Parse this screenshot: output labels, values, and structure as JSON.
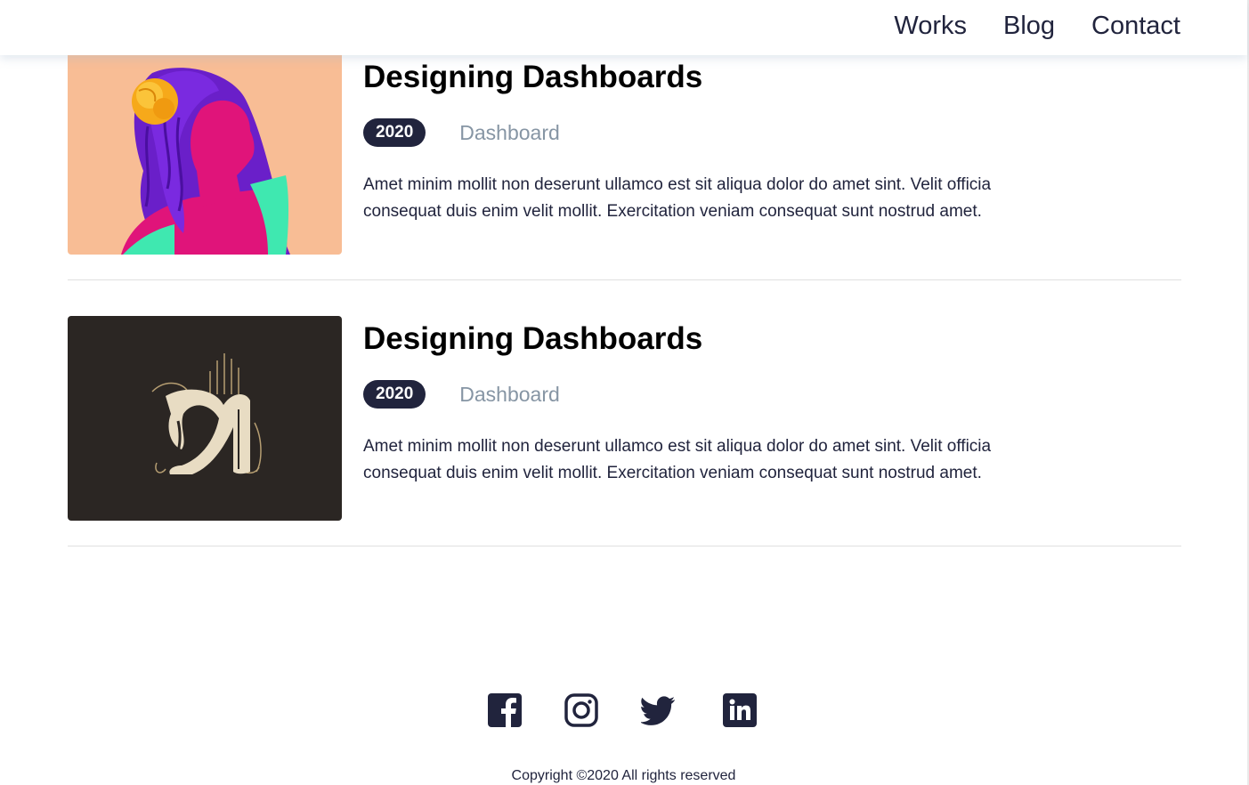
{
  "nav": {
    "items": [
      "Works",
      "Blog",
      "Contact"
    ]
  },
  "posts": [
    {
      "title": "Designing Dashboards",
      "year": "2020",
      "category": "Dashboard",
      "excerpt": "Amet minim mollit non deserunt ullamco est sit aliqua dolor do amet sint. Velit officia consequat duis enim velit mollit. Exercitation veniam consequat sunt nostrud amet."
    },
    {
      "title": "Designing Dashboards",
      "year": "2020",
      "category": "Dashboard",
      "excerpt": "Amet minim mollit non deserunt ullamco est sit aliqua dolor do amet sint. Velit officia consequat duis enim velit mollit. Exercitation veniam consequat sunt nostrud amet."
    }
  ],
  "footer": {
    "social_icons": [
      "facebook-icon",
      "instagram-icon",
      "twitter-icon",
      "linkedin-icon"
    ],
    "copyright": "Copyright ©2020 All rights reserved"
  },
  "colors": {
    "primary": "#21243d",
    "muted": "#8695a4",
    "divider": "#e0e0e0"
  }
}
